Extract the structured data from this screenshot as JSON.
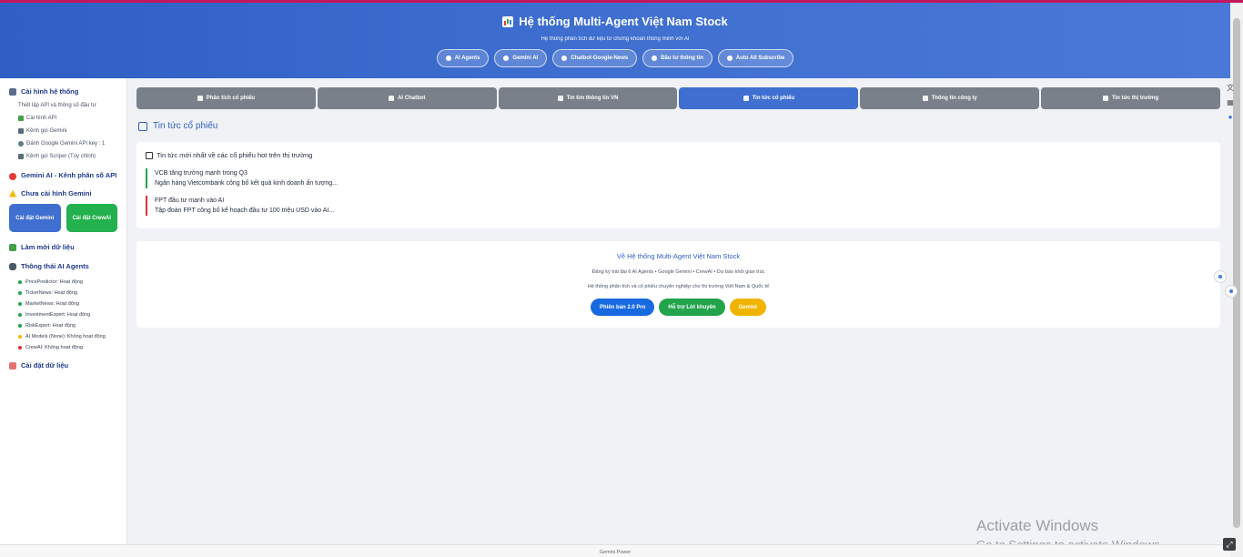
{
  "header": {
    "title": "Hệ thống Multi-Agent Việt Nam Stock",
    "subtitle": "Hệ thống phân tích dữ liệu từ chứng khoán thông minh với AI",
    "pills": [
      {
        "label": "AI Agents",
        "icon": "robot-icon"
      },
      {
        "label": "Gemini AI",
        "icon": "chart-icon"
      },
      {
        "label": "Chatbot-Google-News",
        "icon": "news-icon"
      },
      {
        "label": "Đầu tư thông tin",
        "icon": "search-icon"
      },
      {
        "label": "Auto All Subscribe",
        "icon": "gear-icon"
      }
    ]
  },
  "sidebar": {
    "config_title": "Cài hình hệ thống",
    "config_desc": "Thiết lập API và thông số đầu tư",
    "config_items": [
      "Cài hình API",
      "Kênh gọi Gemini",
      "Đánh Google Gemini API key : 1",
      "Kênh gọi Scriper (Tùy chỉnh)"
    ],
    "gemini_title": "Gemini AI - Kênh phân số API",
    "warning": "Chưa cài hình Gemini",
    "btn_gemini": "Cài đặt Gemini",
    "btn_crewai": "Cài đặt CrewAI",
    "refresh": "Làm mới dữ liệu",
    "agents_title": "Thông thái AI Agents",
    "agents": [
      {
        "label": "PricePredictor: Hoạt động",
        "status": "green"
      },
      {
        "label": "TickerNews: Hoạt động",
        "status": "green"
      },
      {
        "label": "MarketNews: Hoạt động",
        "status": "green"
      },
      {
        "label": "InvestmentExpert: Hoạt động",
        "status": "green"
      },
      {
        "label": "RiskExpert: Hoạt động",
        "status": "green"
      },
      {
        "label": "AI Models (None): Không hoạt động",
        "status": "yellow"
      },
      {
        "label": "CrewAI: Không hoạt động",
        "status": "red"
      }
    ],
    "data_settings": "Cài đặt dữ liệu"
  },
  "tabs": [
    "Phân tích cổ phiếu",
    "AI Chatbot",
    "Tin tìm thông tin VN",
    "Tin tức cổ phiếu",
    "Thông tin công ty",
    "Tin tức thị trường"
  ],
  "main": {
    "section_title": "Tin tức cổ phiếu",
    "card_title": "Tin tức mới nhất về các cổ phiếu hot trên thị trường",
    "news": [
      {
        "title": "VCB tăng trưởng mạnh trong Q3",
        "body": "Ngân hàng Vietcombank công bố kết quả kinh doanh ấn tượng...",
        "color": "green"
      },
      {
        "title": "FPT đầu tư mạnh vào AI",
        "body": "Tập đoàn FPT công bố kế hoạch đầu tư 100 triệu USD vào AI...",
        "color": "red"
      }
    ],
    "about_title": "Về Hệ thống Multi-Agent Việt Nam Stock",
    "about_line1": "Đăng ký trải đại 6 AI Agents • Google Gemini • CrewAI • Dự báo khối gian trúc",
    "about_line2": "Hệ thống phân tích và cổ phiếu chuyên nghiệp cho thị trường Việt Nam & Quốc tế",
    "badges": [
      {
        "label": "Phiên bản 2.0 Pro",
        "color": "#1769e0"
      },
      {
        "label": "Hỗ trợ Lời khuyên",
        "color": "#22a44b"
      },
      {
        "label": "Gemini",
        "color": "#f0b400"
      }
    ]
  },
  "footer": "Gemini Power",
  "watermark": {
    "line1": "Activate Windows",
    "line2": "Go to Settings to activate Windows."
  }
}
